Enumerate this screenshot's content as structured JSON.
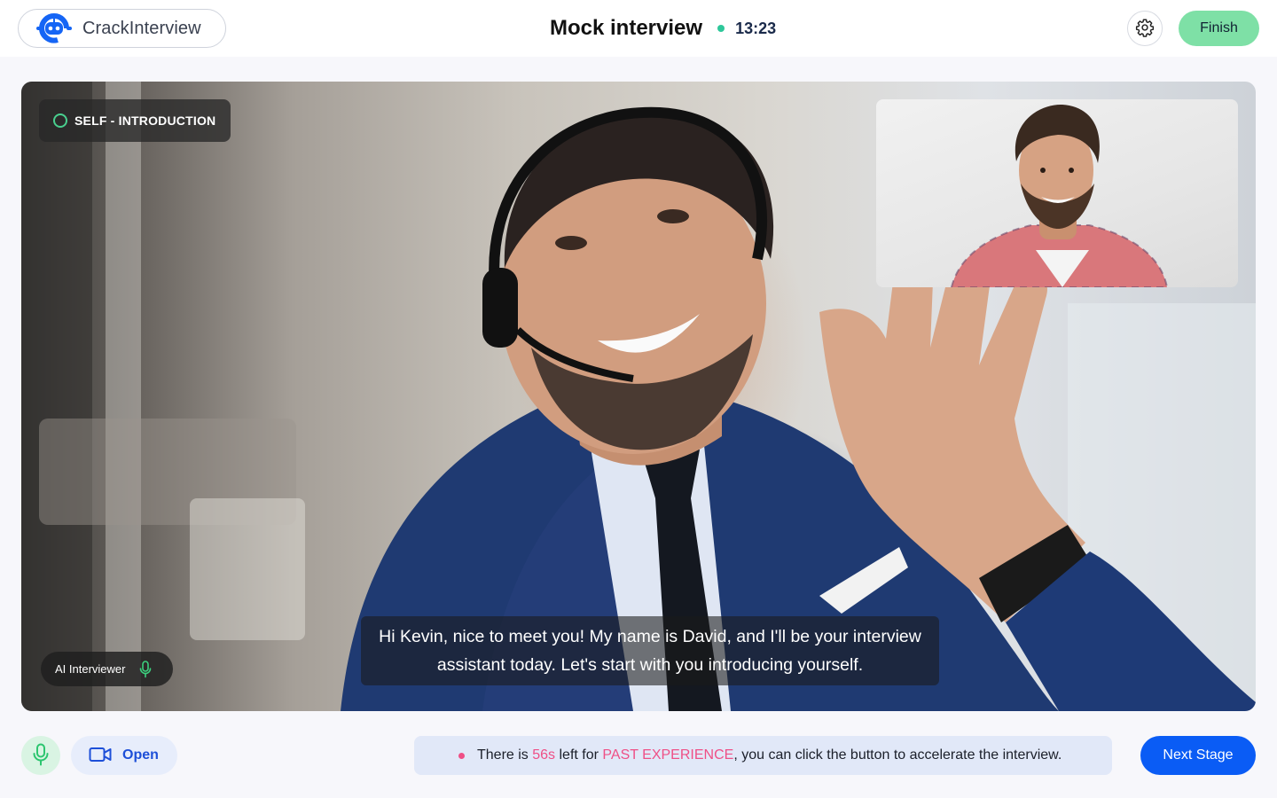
{
  "header": {
    "brand": "CrackInterview",
    "title": "Mock interview",
    "timer": "13:23",
    "finish_label": "Finish"
  },
  "stage": {
    "badge_label": "SELF - INTRODUCTION",
    "speaker_label": "AI Interviewer",
    "caption": "Hi Kevin, nice to meet you! My name is David, and I'll be your interview assistant today. Let's start with you introducing yourself."
  },
  "controls": {
    "camera_label": "Open"
  },
  "notice": {
    "prefix": "There is ",
    "seconds": "56s",
    "middle": " left for ",
    "stage_name": "PAST EXPERIENCE",
    "suffix": ", you can click the button to accelerate the interview."
  },
  "next_label": "Next Stage",
  "icons": {
    "logo": "robot-logo-icon",
    "live": "live-dot-icon",
    "settings": "gear-icon",
    "stage_status": "ring-icon",
    "speaker_mic": "microphone-icon",
    "mic_toggle": "microphone-icon",
    "camera": "video-camera-icon",
    "notice_dot": "dot-icon"
  },
  "colors": {
    "accent_blue": "#0a5cf5",
    "finish_green": "#7ee0a6",
    "live_green": "#2ec79a",
    "highlight_pink": "#ef4f86",
    "notice_bg": "#e1e8f8"
  }
}
